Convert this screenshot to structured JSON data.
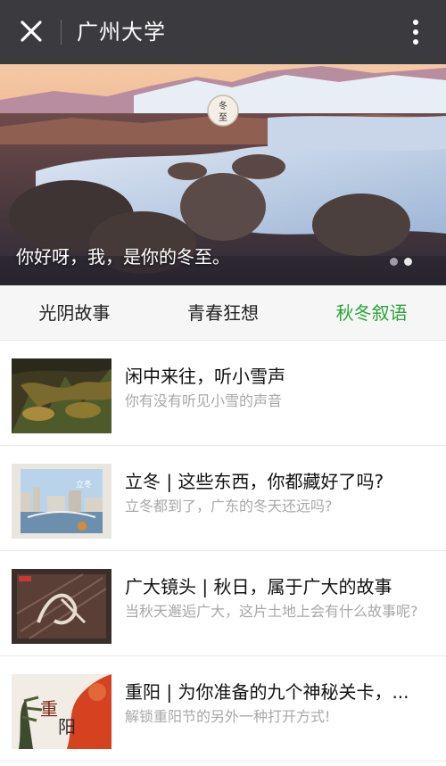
{
  "header": {
    "title": "广州大学"
  },
  "banner": {
    "caption": "你好呀，我，是你的冬至。",
    "badge_text": "冬至",
    "slides": 2,
    "active_slide": 2
  },
  "tabs": [
    {
      "label": "光阴故事",
      "active": false
    },
    {
      "label": "青春狂想",
      "active": false
    },
    {
      "label": "秋冬叙语",
      "active": true
    }
  ],
  "articles": [
    {
      "title": "闲中来往，听小雪声",
      "desc": "你有没有听见小雪的声音"
    },
    {
      "title": "立冬 | 这些东西，你都藏好了吗?",
      "desc": "立冬都到了，广东的冬天还远吗?"
    },
    {
      "title": "广大镜头 | 秋日，属于广大的故事",
      "desc": "当秋天邂逅广大，这片土地上会有什么故事呢?"
    },
    {
      "title": "重阳 | 为你准备的九个神秘关卡，...",
      "desc": "解锁重阳节的另外一种打开方式!"
    }
  ],
  "colors": {
    "topbar": "#3b3a3f",
    "active_tab": "#2aa53a",
    "tabs_bg": "#f6f6f6",
    "desc_text": "#a8a8a8"
  }
}
